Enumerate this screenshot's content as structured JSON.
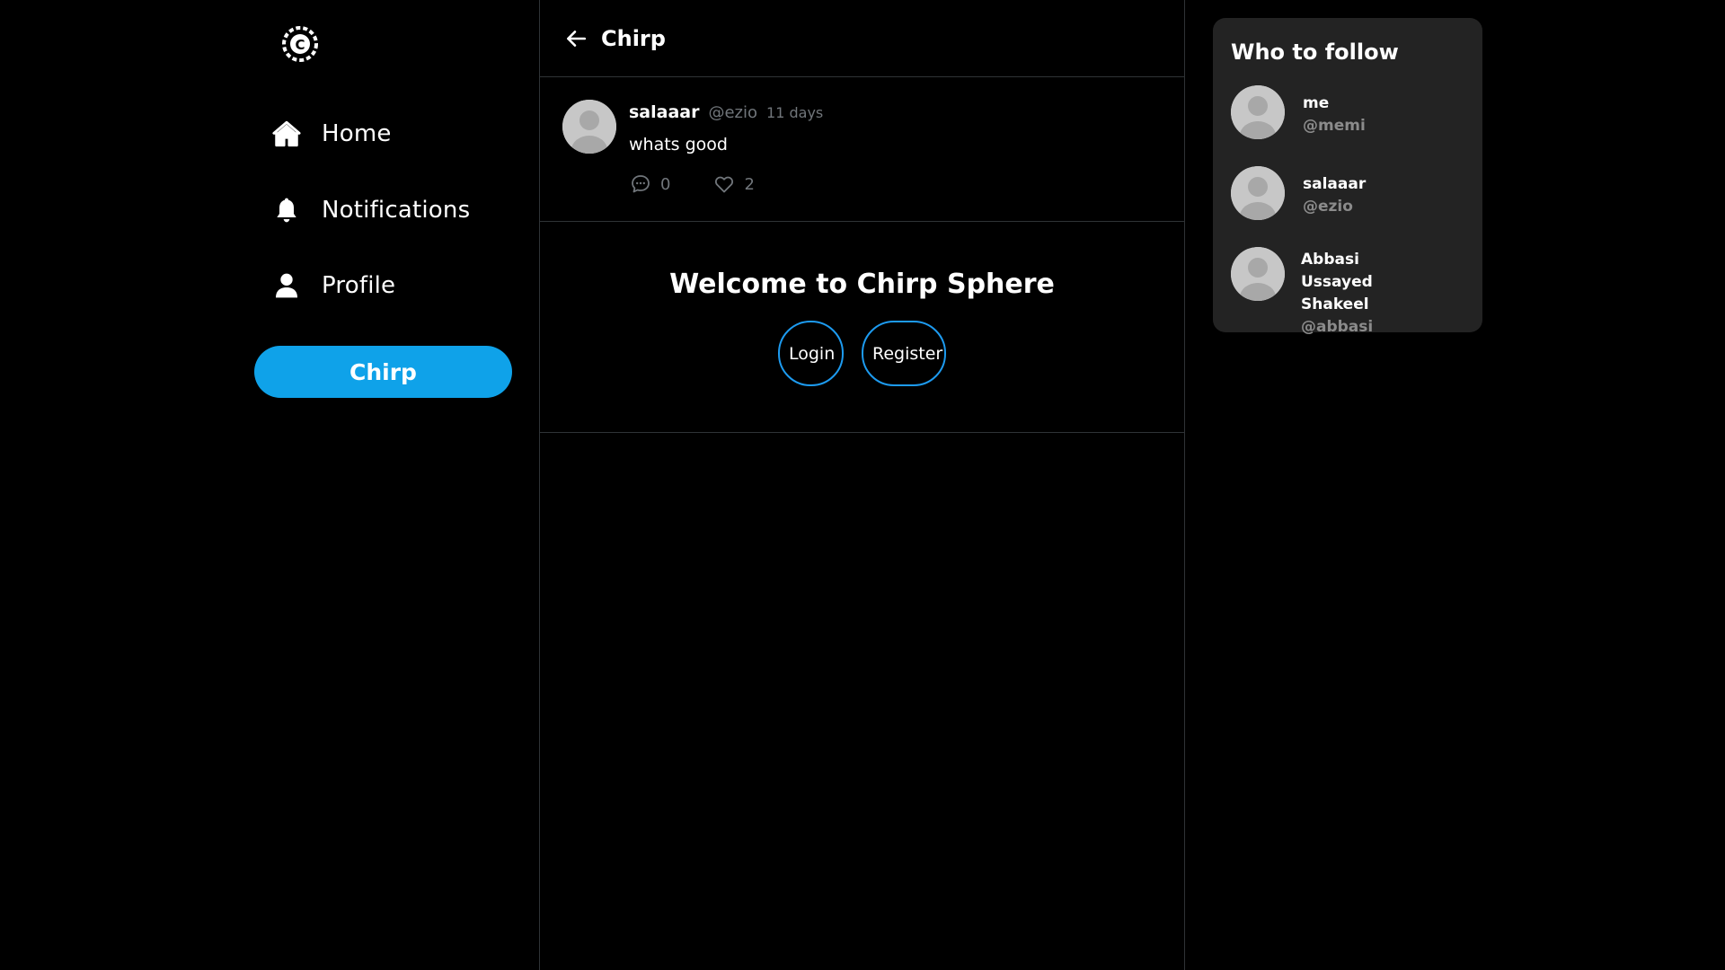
{
  "sidebar": {
    "nav": [
      {
        "label": "Home",
        "icon": "home-icon"
      },
      {
        "label": "Notifications",
        "icon": "bell-icon"
      },
      {
        "label": "Profile",
        "icon": "user-icon"
      }
    ],
    "chirp_button": "Chirp"
  },
  "main": {
    "header_title": "Chirp",
    "post": {
      "author": "salaaar",
      "handle": "@ezio",
      "time": "11 days",
      "text": "whats good",
      "comments": "0",
      "likes": "2"
    },
    "welcome": {
      "title": "Welcome to Chirp Sphere",
      "login": "Login",
      "register": "Register"
    }
  },
  "who_to_follow": {
    "title": "Who to follow",
    "users": [
      {
        "name": "me",
        "handle": "@memi"
      },
      {
        "name": "salaaar",
        "handle": "@ezio"
      },
      {
        "name": "Abbasi Ussayed Shakeel",
        "handle": "@abbasi"
      }
    ]
  },
  "colors": {
    "accent": "#0fa2e9",
    "button_outline": "#1d9bf0",
    "muted_text": "#71767b",
    "panel_bg": "#232323",
    "background": "#000000"
  }
}
